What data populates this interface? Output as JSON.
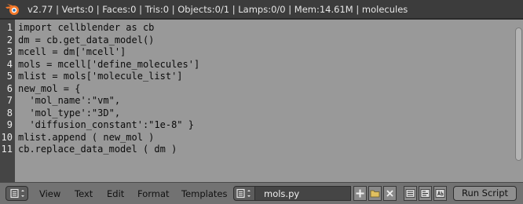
{
  "info_bar": {
    "text": "v2.77 | Verts:0 | Faces:0 | Tris:0 | Objects:0/1 | Lamps:0/0 | Mem:14.61M | molecules",
    "logo_icon": "blender-logo-icon"
  },
  "editor": {
    "line_numbers": [
      "1",
      "2",
      "3",
      "4",
      "5",
      "6",
      "7",
      "8",
      "9",
      "10",
      "11"
    ],
    "lines": [
      "import cellblender as cb",
      "dm = cb.get_data_model()",
      "mcell = dm['mcell']",
      "mols = mcell['define_molecules']",
      "mlist = mols['molecule_list']",
      "new_mol = {",
      "  'mol_name':\"vm\",",
      "  'mol_type':\"3D\",",
      "  'diffusion_constant':\"1e-8\" }",
      "mlist.append ( new_mol )",
      "cb.replace_data_model ( dm )"
    ]
  },
  "header": {
    "editor_type_icon": "text-editor-icon",
    "menus": [
      "View",
      "Text",
      "Edit",
      "Format",
      "Templates"
    ],
    "text_browse_icon": "text-browse-icon",
    "text_name": "mols.py",
    "add_icon": "plus-icon",
    "open_icon": "folder-icon",
    "unlink_icon": "close-icon",
    "toggle_icons": [
      "line-numbers-icon",
      "word-wrap-icon",
      "syntax-highlight-icon"
    ],
    "run_label": "Run Script"
  },
  "colors": {
    "editor_bg": "#999999",
    "gutter_bg": "#454545",
    "header_bg": "#727272",
    "infobar_bg": "#3c3c3c"
  }
}
